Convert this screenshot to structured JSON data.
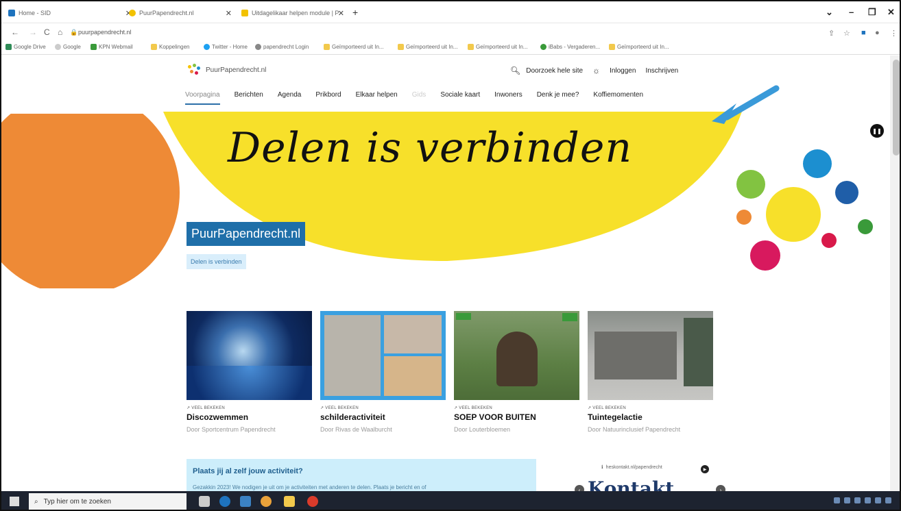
{
  "browser": {
    "tabs": [
      {
        "label": "Home - SID",
        "favicon_color": "#1e73be"
      },
      {
        "label": "PuurPapendrecht.nl",
        "favicon_color": "#f2c200"
      },
      {
        "label": "Uitdagelikaar helpen module | P",
        "favicon_color": "#f2c200"
      }
    ],
    "new_tab": "+",
    "window_controls": [
      "⌄",
      "–",
      "❐",
      "✕"
    ],
    "nav": {
      "back": "←",
      "forward": "→",
      "reload": "C",
      "home": "⌂"
    },
    "url": "puurpapendrecht.nl",
    "bookmarks": [
      "Google Drive",
      "Google",
      "KPN Webmail",
      "Koppelingen",
      "Twitter - Home",
      "papendrecht Login",
      "Geïmporteerd uit In...",
      "Geïmporteerd uit In...",
      "Geïmporteerd uit In...",
      "iBabs - Vergaderen...",
      "Geïmporteerd uit In..."
    ]
  },
  "site": {
    "logo_text": "PuurPapendrecht.nl",
    "header": {
      "search_label": "Doorzoek hele site",
      "login": "Inloggen",
      "register": "Inschrijven"
    },
    "nav": [
      "Voorpagina",
      "Berichten",
      "Agenda",
      "Prikbord",
      "Elkaar helpen",
      "Gids",
      "Sociale kaart",
      "Inwoners",
      "Denk je mee?",
      "Koffiemomenten"
    ],
    "hero": {
      "script_text": "Delen is verbinden",
      "title": "PuurPapendrecht.nl",
      "tagline": "Delen is verbinden"
    },
    "cards": [
      {
        "meta": "VEEL BEKEKEN",
        "title": "Discozwemmen",
        "by": "Door Sportcentrum Papendrecht"
      },
      {
        "meta": "VEEL BEKEKEN",
        "title": "schilderactiviteit",
        "by": "Door Rivas de Waalburcht"
      },
      {
        "meta": "VEEL BEKEKEN",
        "title": "SOEP VOOR BUITEN",
        "by": "Door Louterbloemen"
      },
      {
        "meta": "VEEL BEKEKEN",
        "title": "Tuintegelactie",
        "by": "Door Natuurinclusief Papendrecht"
      }
    ],
    "cta": {
      "title": "Plaats jij al zelf jouw activiteit?",
      "text": "Gezakkin 2023! We nodigen je uit om je activiteiten met anderen te delen. Plaats je bericht en of"
    },
    "sidebar": {
      "label": "heskontakt.nl/papendrecht",
      "kontakt": "Kontakt"
    },
    "colors": {
      "accent_blue": "#1f6fa9",
      "hero_yellow": "#f7e02a",
      "hero_orange": "#ee8a36"
    }
  },
  "taskbar": {
    "search_placeholder": "Typ hier om te zoeken"
  }
}
